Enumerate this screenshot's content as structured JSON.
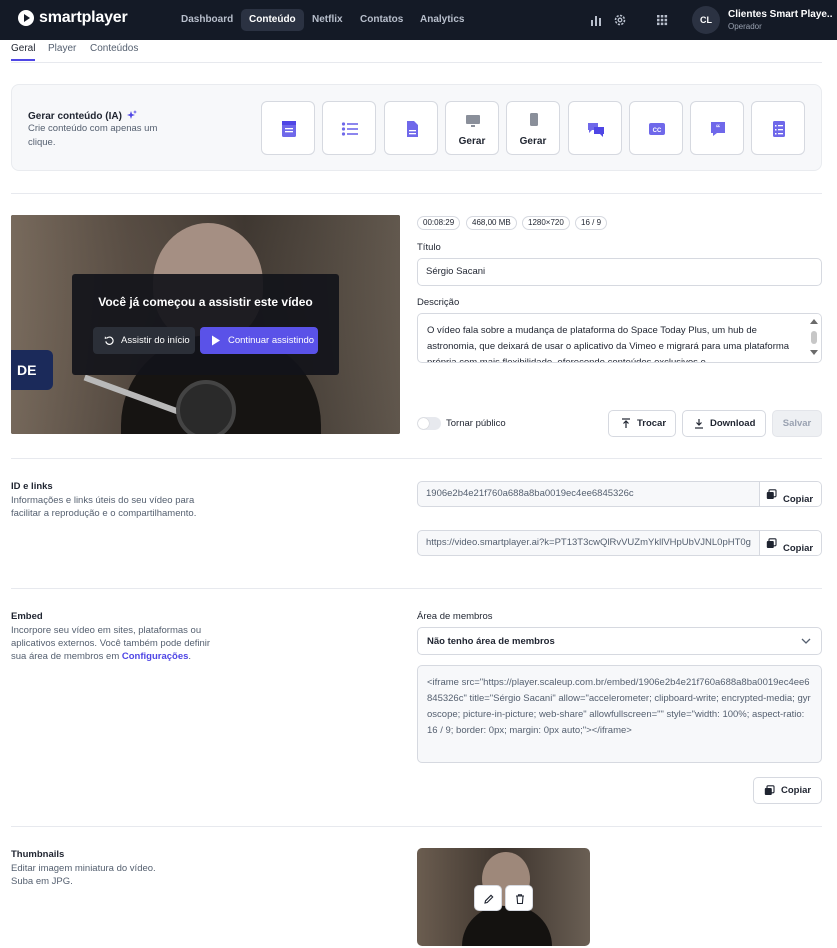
{
  "nav": {
    "brand": "smartplayer",
    "links": [
      "Dashboard",
      "Conteúdo",
      "Netflix",
      "Contatos",
      "Analytics"
    ],
    "active": "Conteúdo",
    "icons": [
      "bar-chart-icon",
      "settings-icon",
      "apps-grid-icon"
    ],
    "user": {
      "initials": "CL",
      "name": "Clientes Smart Playe...",
      "role": "Operador"
    }
  },
  "tabs": {
    "items": [
      "Geral",
      "Player",
      "Conteúdos"
    ],
    "active": "Geral"
  },
  "ai": {
    "title": "Gerar conteúdo (IA)",
    "subtitle": "Crie conteúdo com apenas um clique.",
    "buttons": [
      {
        "icon": "article-icon",
        "label": ""
      },
      {
        "icon": "list-icon",
        "label": ""
      },
      {
        "icon": "document-icon",
        "label": ""
      },
      {
        "icon": "monitor-icon",
        "label": "Gerar"
      },
      {
        "icon": "mobile-icon",
        "label": "Gerar"
      },
      {
        "icon": "chat-bubbles-icon",
        "label": ""
      },
      {
        "icon": "closed-captions-icon",
        "label": ""
      },
      {
        "icon": "quote-icon",
        "label": ""
      },
      {
        "icon": "checklist-icon",
        "label": ""
      }
    ]
  },
  "video": {
    "resume_title": "Você já começou a assistir este vídeo",
    "restart_label": "Assistir do início",
    "continue_label": "Continuar assistindo",
    "watermark": "DE"
  },
  "meta": {
    "chips": [
      "00:08:29",
      "468,00 MB",
      "1280×720",
      "16 / 9"
    ],
    "title_label": "Título",
    "title_value": "Sérgio Sacani",
    "description_label": "Descrição",
    "description_value": "O vídeo fala sobre a mudança de plataforma do Space Today Plus, um hub de astronomia, que deixará de usar o aplicativo da Vimeo e migrará para uma plataforma própria com mais flexibilidade, oferecendo conteúdos exclusivos e",
    "public_label": "Tornar público",
    "public_on": false,
    "swap_label": "Trocar",
    "download_label": "Download",
    "save_label": "Salvar"
  },
  "ids": {
    "title": "ID e links",
    "description": "Informações e links úteis do seu vídeo para facilitar a reprodução e o compartilhamento.",
    "video_id": "1906e2b4e21f760a688a8ba0019ec4ee6845326c",
    "share_url": "https://video.smartplayer.ai?k=PT13T3cwQlRvVUZmYkllVHpUbVJNL0pHT0g",
    "copy_label": "Copiar"
  },
  "embed": {
    "title": "Embed",
    "description": "Incorpore seu vídeo em sites, plataformas ou aplicativos externos. Você também pode definir sua área de membros em",
    "link_text": "Configurações",
    "link_suffix": ".",
    "members_label": "Área de membros",
    "members_value": "Não tenho área de membros",
    "code": "<iframe src=\"https://player.scaleup.com.br/embed/1906e2b4e21f760a688a8ba0019ec4ee6845326c\" title=\"Sérgio Sacani\" allow=\"accelerometer; clipboard-write; encrypted-media; gyroscope; picture-in-picture; web-share\" allowfullscreen=\"\" style=\"width: 100%; aspect-ratio: 16 / 9; border: 0px; margin: 0px auto;\"></iframe>",
    "copy_label": "Copiar"
  },
  "thumbnails": {
    "title": "Thumbnails",
    "description": "Editar imagem miniatura do vídeo. Suba em JPG."
  }
}
